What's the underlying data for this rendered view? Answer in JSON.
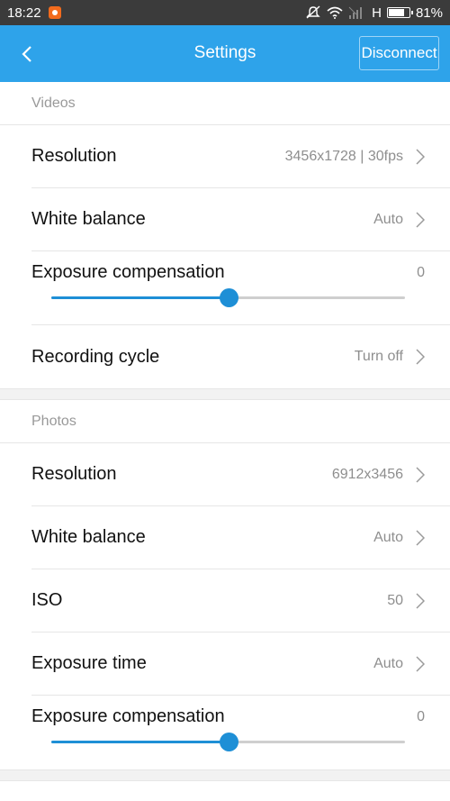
{
  "status_bar": {
    "time": "18:22",
    "network": "H",
    "battery_text": "81%",
    "battery_level": 0.81
  },
  "app_bar": {
    "title": "Settings",
    "disconnect_label": "Disconnect"
  },
  "videos": {
    "header": "Videos",
    "resolution": {
      "label": "Resolution",
      "value": "3456x1728 | 30fps"
    },
    "white_balance": {
      "label": "White balance",
      "value": "Auto"
    },
    "exposure_compensation": {
      "label": "Exposure compensation",
      "value": "0",
      "level": 0.5
    },
    "recording_cycle": {
      "label": "Recording cycle",
      "value": "Turn off"
    }
  },
  "photos": {
    "header": "Photos",
    "resolution": {
      "label": "Resolution",
      "value": "6912x3456"
    },
    "white_balance": {
      "label": "White balance",
      "value": "Auto"
    },
    "iso": {
      "label": "ISO",
      "value": "50"
    },
    "exposure_time": {
      "label": "Exposure time",
      "value": "Auto"
    },
    "exposure_compensation": {
      "label": "Exposure compensation",
      "value": "0",
      "level": 0.5
    }
  },
  "colors": {
    "accent": "#2ea3ea",
    "slider": "#1e8fd6",
    "status_bar": "#3b3b3b"
  }
}
